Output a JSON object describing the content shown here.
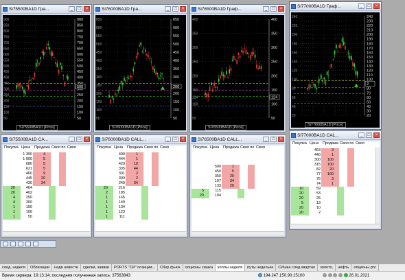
{
  "colors": {
    "chart_bg": "#000000",
    "bid_bg": "#a8e49a",
    "ask_bg": "#f2a6a6",
    "up_candle": "#3cd23c",
    "down_candle": "#e03a3a"
  },
  "charts": [
    {
      "title": "Si75500BA1D Гра...",
      "label": "Si75500BA1D [Price]",
      "ticks": [
        "900",
        "850",
        "800",
        "750",
        "700",
        "650",
        "600",
        "550",
        "500",
        "450",
        "400",
        "350",
        "300",
        "250",
        "200",
        "150",
        "100",
        "50"
      ],
      "ymin": 50,
      "ymax": 900,
      "current": "500"
    },
    {
      "title": "Si76000BA1D Гра...",
      "label": "Si76000BA1D [Price]",
      "ticks": [
        "650",
        "600",
        "550",
        "500",
        "450",
        "400",
        "350",
        "300",
        "250",
        "200",
        "150",
        "100",
        "50"
      ],
      "ymin": 50,
      "ymax": 650,
      "current": "200"
    },
    {
      "title": "Si76500BA1D Граф...",
      "label": "Si76500BA1D [Price]",
      "ticks": [
        "400",
        "350",
        "300",
        "250",
        "200",
        "150",
        "124",
        "100",
        "50"
      ],
      "ymin": 50,
      "ymax": 400,
      "current": "124"
    },
    {
      "title": "Si77000BA1D Граф...",
      "label": "Si77000BA1D [Price]",
      "ticks": [
        "240",
        "230",
        "220",
        "210",
        "200",
        "190",
        "180",
        "170",
        "160",
        "150",
        "140",
        "130",
        "120",
        "110",
        "100",
        "90",
        "80",
        "70",
        "60",
        "50",
        "40",
        "30",
        "20"
      ],
      "ymin": 20,
      "ymax": 240,
      "current": "2"
    }
  ],
  "quotes": {
    "headers": [
      "Покупка",
      "Цена",
      "Продажа",
      "Своя по",
      "Своя"
    ],
    "tables": [
      {
        "title": "Si75500BA1D CA...",
        "asks": [
          [
            "1 390",
            "4"
          ],
          [
            "1 000",
            "5"
          ],
          [
            "680",
            "5"
          ],
          [
            "621",
            "5"
          ],
          [
            "460",
            "9"
          ],
          [
            "445",
            "20"
          ],
          [
            "430",
            "34"
          ]
        ],
        "bids": [
          [
            "20",
            "404"
          ],
          [
            "20",
            "402"
          ],
          [
            "4",
            "250"
          ],
          [
            "4",
            "200"
          ],
          [
            "1",
            "150"
          ],
          [
            "1",
            "100"
          ],
          [
            "1",
            "50"
          ]
        ]
      },
      {
        "title": "Si76000BA1D CALL...",
        "asks": [
          [
            "499",
            "1"
          ],
          [
            "444",
            "1"
          ],
          [
            "420",
            "10"
          ],
          [
            "335",
            "44"
          ],
          [
            "301",
            "2"
          ],
          [
            "300",
            "2"
          ],
          [
            "240",
            "34"
          ]
        ],
        "bids": [
          [
            "20",
            "216"
          ],
          [
            "2",
            "185"
          ],
          [
            "1",
            "165"
          ],
          [
            "1",
            "149"
          ],
          [
            "1",
            "134"
          ],
          [
            "1",
            "123"
          ],
          [
            "1",
            "111"
          ]
        ]
      },
      {
        "title": "Si76500BA1D CALL...",
        "asks": [
          [
            "500",
            "1"
          ],
          [
            "450",
            "5"
          ],
          [
            "350",
            "20"
          ],
          [
            "197",
            "34"
          ],
          [
            "133",
            "20"
          ]
        ],
        "bids": [
          [
            "5",
            "115"
          ],
          [
            "20",
            "104"
          ]
        ]
      },
      {
        "title": "Si77000BA1D CAL...",
        "asks": [
          [
            "463",
            "3"
          ],
          [
            "440",
            "1"
          ],
          [
            "300",
            "100"
          ],
          [
            "315",
            "100"
          ],
          [
            "82",
            "20"
          ],
          [
            "77",
            "100"
          ],
          [
            "76",
            "3"
          ],
          [
            "74",
            "1"
          ]
        ],
        "bids": [
          [
            "10",
            "59"
          ],
          [
            "20",
            "53"
          ],
          [
            "20",
            "25"
          ],
          [
            "5",
            "13"
          ],
          [
            "20",
            "10"
          ],
          [
            "20",
            "2"
          ]
        ]
      }
    ]
  },
  "tabs": [
    "след. неделя",
    "Облигации",
    "недв новости",
    "сделки, заявки",
    "PORTS \"СИ\" позиции...",
    "Сбер фьюч",
    "опционы сишка",
    "коллы неделя",
    "путы неделька",
    "СИшка след квартал",
    "золото,",
    "нефть",
    "опционы ртс"
  ],
  "active_tab": 7,
  "status": {
    "server_time": "Время сервера: 19:13:14; последняя полученная запись: 37563843",
    "ip": "194.247.150.90:15100",
    "date": "26.01.2021"
  }
}
